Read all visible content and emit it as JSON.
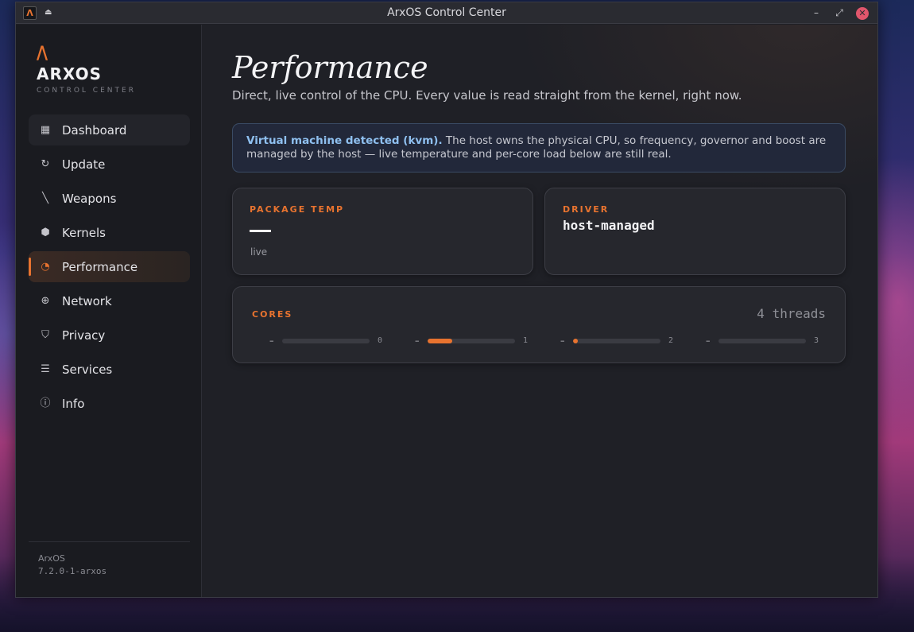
{
  "window": {
    "title": "ArxOS Control Center"
  },
  "brand": {
    "mark": "/\\",
    "name": "ARXOS",
    "subtitle": "CONTROL CENTER"
  },
  "sidebar": {
    "items": [
      {
        "label": "Dashboard",
        "icon": "dashboard-icon"
      },
      {
        "label": "Update",
        "icon": "refresh-icon"
      },
      {
        "label": "Weapons",
        "icon": "knife-icon"
      },
      {
        "label": "Kernels",
        "icon": "hexagon-icon"
      },
      {
        "label": "Performance",
        "icon": "gauge-icon",
        "active": true
      },
      {
        "label": "Network",
        "icon": "globe-icon"
      },
      {
        "label": "Privacy",
        "icon": "shield-icon"
      },
      {
        "label": "Services",
        "icon": "list-icon"
      },
      {
        "label": "Info",
        "icon": "info-icon"
      }
    ],
    "footer": {
      "name": "ArxOS",
      "version": "7.2.0-1-arxos"
    }
  },
  "main": {
    "title": "Performance",
    "subtitle": "Direct, live control of the CPU. Every value is read straight from the kernel, right now.",
    "notice": {
      "strong": "Virtual machine detected (kvm).",
      "text": " The host owns the physical CPU, so frequency, governor and boost are managed by the host — live temperature and per-core load below are still real."
    },
    "package_temp": {
      "label": "PACKAGE TEMP",
      "value": "—",
      "note": "live"
    },
    "driver": {
      "label": "DRIVER",
      "value": "host-managed"
    },
    "cores": {
      "label": "CORES",
      "threads": "4 threads",
      "items": [
        {
          "value": "–",
          "index": "0",
          "load": 0
        },
        {
          "value": "–",
          "index": "1",
          "load": 0.28
        },
        {
          "value": "–",
          "index": "2",
          "load": 0.06
        },
        {
          "value": "–",
          "index": "3",
          "load": 0
        }
      ]
    }
  },
  "colors": {
    "accent": "#e8732f",
    "notice_border": "#3a4b64",
    "notice_strong": "#8fc0f0"
  }
}
